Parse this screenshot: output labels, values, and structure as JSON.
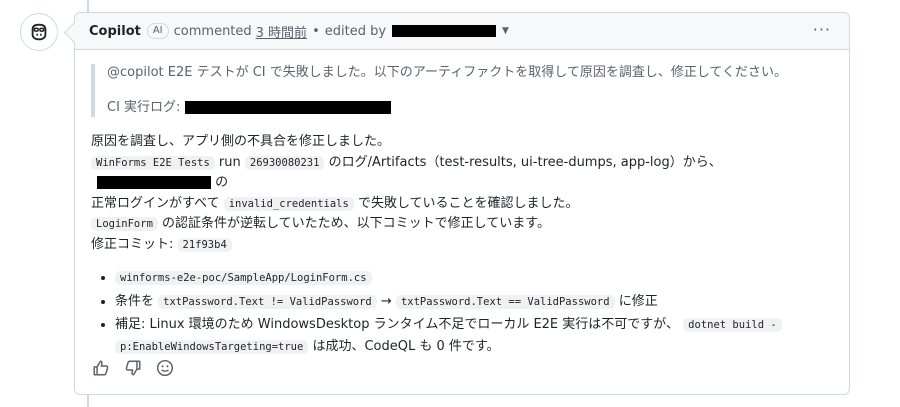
{
  "comment": {
    "author": "Copilot",
    "badge": "AI",
    "action": "commented",
    "time": "3 時間前",
    "separator": "•",
    "edited_by": "edited by",
    "more_menu": "···"
  },
  "quote": {
    "line1": "@copilot E2E テストが CI で失敗しました。以下のアーティファクトを取得して原因を調査し、修正してください。",
    "line2": "CI 実行ログ:"
  },
  "body": {
    "intro": "原因を調査し、アプリ側の不具合を修正しました。",
    "code_tests": "WinForms E2E Tests",
    "run": " run ",
    "code_run_id": "26930080231",
    "artifacts_text": " のログ/Artifacts（test-results, ui-tree-dumps, app-log）から、",
    "no": " の",
    "line3_pre": "正常ログインがすべて ",
    "code_invalid": "invalid_credentials",
    "line3_post": " で失敗していることを確認しました。",
    "code_loginform": "LoginForm",
    "line4": " の認証条件が逆転していたため、以下コミットで修正しています。",
    "commit_label": "修正コミット: ",
    "code_commit": "21f93b4"
  },
  "list": {
    "item1_code": "winforms-e2e-poc/SampleApp/LoginForm.cs",
    "item2_pre": "条件を ",
    "item2_code_a": "txtPassword.Text != ValidPassword",
    "item2_arrow": " → ",
    "item2_code_b": "txtPassword.Text == ValidPassword",
    "item2_post": " に修正",
    "item3_pre": "補足: Linux 環境のため WindowsDesktop ランタイム不足でローカル E2E 実行は不可ですが、",
    "item3_code_a": "dotnet build -",
    "item3_code_b": "p:EnableWindowsTargeting=true",
    "item3_post": " は成功、CodeQL も 0 件です。"
  },
  "icons": {
    "avatar": "copilot-icon",
    "thumbs_up": "thumbs-up-icon",
    "thumbs_down": "thumbs-down-icon",
    "emoji": "smiley-icon",
    "caret": "caret-down-icon"
  },
  "colors": {
    "border": "#d1d9e0",
    "header_bg": "#f6f8fa",
    "muted": "#59636e",
    "code_bg": "#eff1f3",
    "redaction": "#000000"
  }
}
